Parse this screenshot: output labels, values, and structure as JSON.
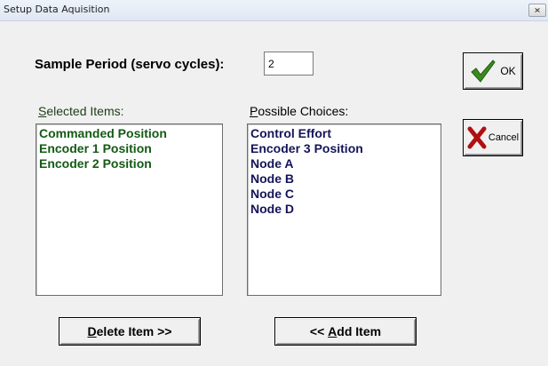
{
  "window": {
    "title": "Setup Data Aquisition",
    "close_icon": "close-icon"
  },
  "sample": {
    "label": "Sample Period (servo cycles):",
    "value": "2"
  },
  "selected": {
    "label_first": "S",
    "label_rest": "elected Items:",
    "items": [
      "Commanded Position",
      "Encoder 1 Position",
      "Encoder 2 Position"
    ]
  },
  "possible": {
    "label_first": "P",
    "label_rest": "ossible Choices:",
    "items": [
      "Control Effort",
      "Encoder 3 Position",
      "Node A",
      "Node B",
      "Node C",
      "Node D"
    ]
  },
  "buttons": {
    "ok_label": "OK",
    "ok_icon": "checkmark-icon",
    "cancel_label": "Cancel",
    "cancel_icon": "x-icon",
    "delete_first": "D",
    "delete_rest": "elete Item >>",
    "add_prefix": "<< ",
    "add_first": "A",
    "add_rest": "dd Item"
  },
  "colors": {
    "selected_text": "#135a13",
    "possible_text": "#14145a",
    "ok_check": "#3a8a1e",
    "cancel_x": "#b01010"
  }
}
